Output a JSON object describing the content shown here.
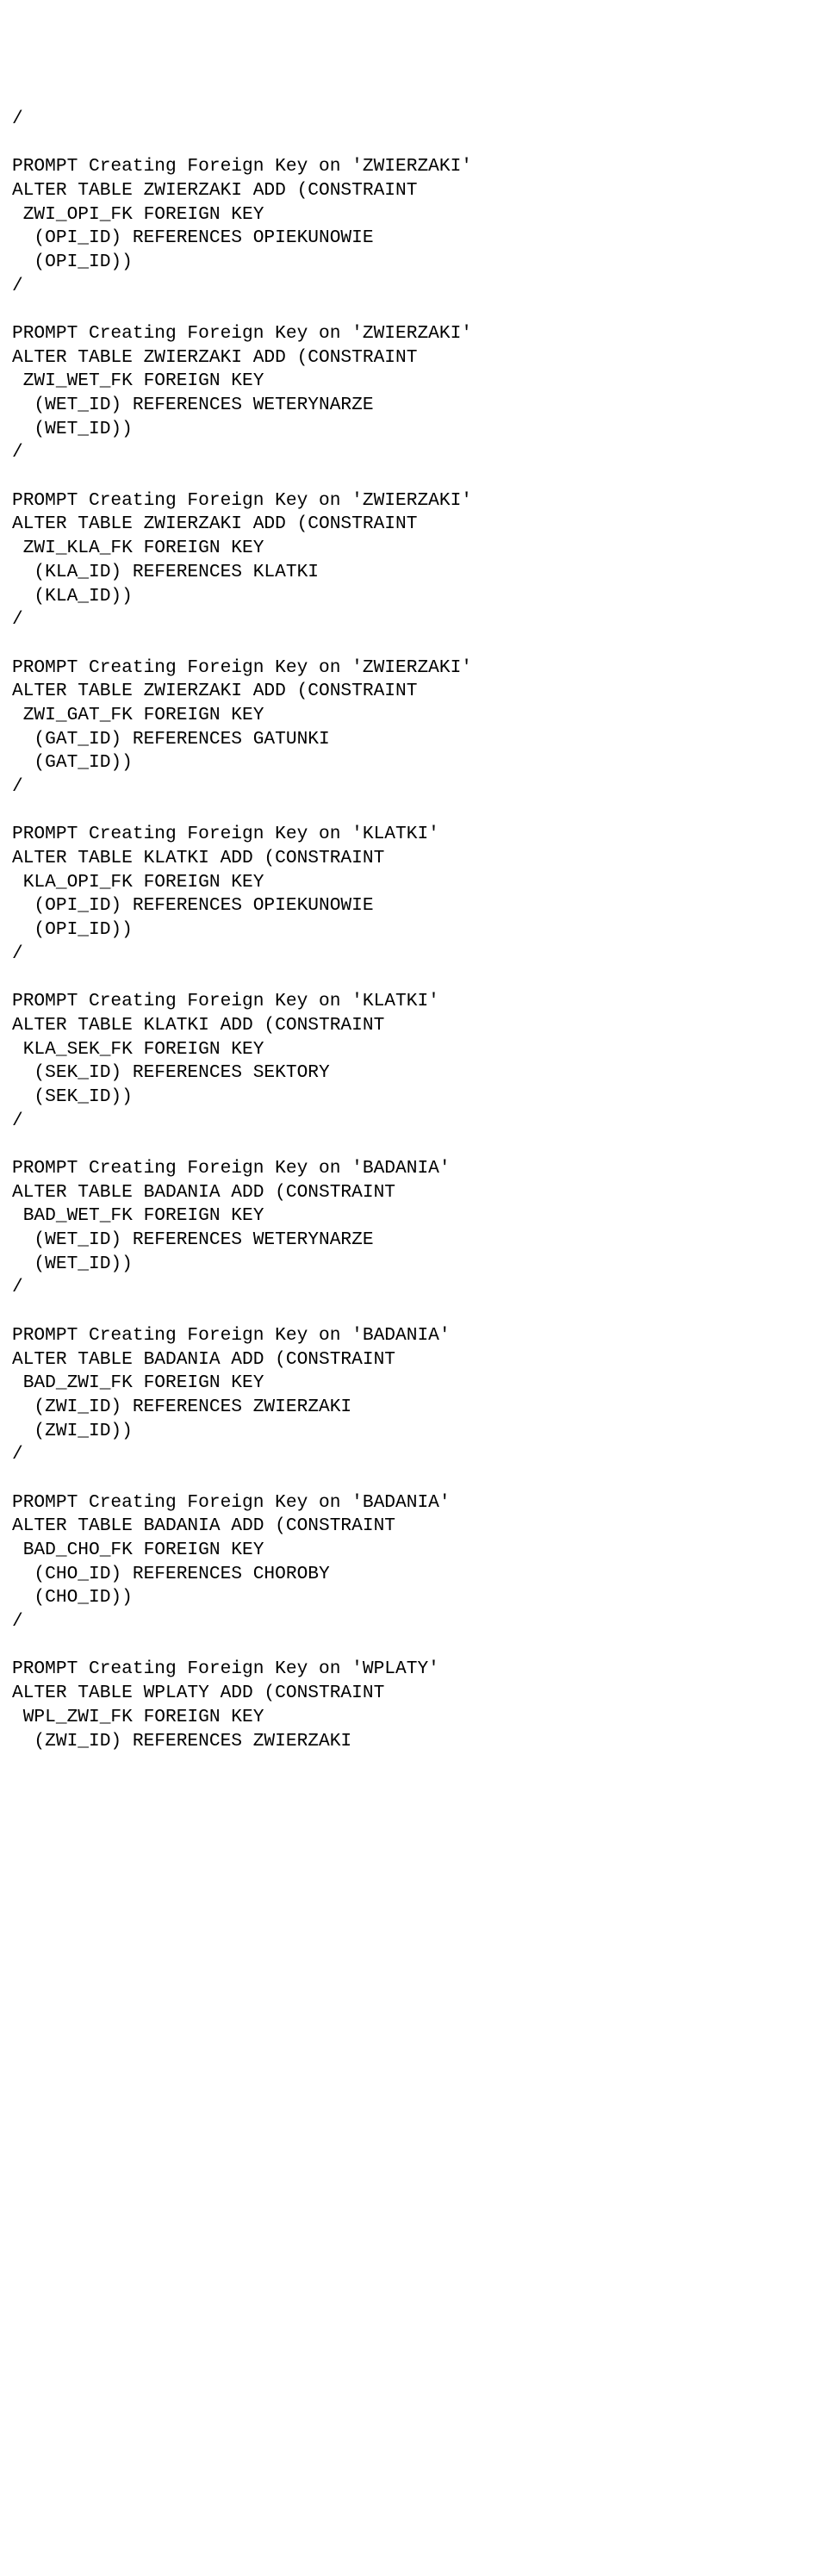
{
  "lines": [
    "/",
    "",
    "PROMPT Creating Foreign Key on 'ZWIERZAKI'",
    "ALTER TABLE ZWIERZAKI ADD (CONSTRAINT",
    " ZWI_OPI_FK FOREIGN KEY",
    "  (OPI_ID) REFERENCES OPIEKUNOWIE",
    "  (OPI_ID))",
    "/",
    "",
    "PROMPT Creating Foreign Key on 'ZWIERZAKI'",
    "ALTER TABLE ZWIERZAKI ADD (CONSTRAINT",
    " ZWI_WET_FK FOREIGN KEY",
    "  (WET_ID) REFERENCES WETERYNARZE",
    "  (WET_ID))",
    "/",
    "",
    "PROMPT Creating Foreign Key on 'ZWIERZAKI'",
    "ALTER TABLE ZWIERZAKI ADD (CONSTRAINT",
    " ZWI_KLA_FK FOREIGN KEY",
    "  (KLA_ID) REFERENCES KLATKI",
    "  (KLA_ID))",
    "/",
    "",
    "PROMPT Creating Foreign Key on 'ZWIERZAKI'",
    "ALTER TABLE ZWIERZAKI ADD (CONSTRAINT",
    " ZWI_GAT_FK FOREIGN KEY",
    "  (GAT_ID) REFERENCES GATUNKI",
    "  (GAT_ID))",
    "/",
    "",
    "PROMPT Creating Foreign Key on 'KLATKI'",
    "ALTER TABLE KLATKI ADD (CONSTRAINT",
    " KLA_OPI_FK FOREIGN KEY",
    "  (OPI_ID) REFERENCES OPIEKUNOWIE",
    "  (OPI_ID))",
    "/",
    "",
    "PROMPT Creating Foreign Key on 'KLATKI'",
    "ALTER TABLE KLATKI ADD (CONSTRAINT",
    " KLA_SEK_FK FOREIGN KEY",
    "  (SEK_ID) REFERENCES SEKTORY",
    "  (SEK_ID))",
    "/",
    "",
    "PROMPT Creating Foreign Key on 'BADANIA'",
    "ALTER TABLE BADANIA ADD (CONSTRAINT",
    " BAD_WET_FK FOREIGN KEY",
    "  (WET_ID) REFERENCES WETERYNARZE",
    "  (WET_ID))",
    "/",
    "",
    "PROMPT Creating Foreign Key on 'BADANIA'",
    "ALTER TABLE BADANIA ADD (CONSTRAINT",
    " BAD_ZWI_FK FOREIGN KEY",
    "  (ZWI_ID) REFERENCES ZWIERZAKI",
    "  (ZWI_ID))",
    "/",
    "",
    "PROMPT Creating Foreign Key on 'BADANIA'",
    "ALTER TABLE BADANIA ADD (CONSTRAINT",
    " BAD_CHO_FK FOREIGN KEY",
    "  (CHO_ID) REFERENCES CHOROBY",
    "  (CHO_ID))",
    "/",
    "",
    "PROMPT Creating Foreign Key on 'WPLATY'",
    "ALTER TABLE WPLATY ADD (CONSTRAINT",
    " WPL_ZWI_FK FOREIGN KEY",
    "  (ZWI_ID) REFERENCES ZWIERZAKI"
  ]
}
